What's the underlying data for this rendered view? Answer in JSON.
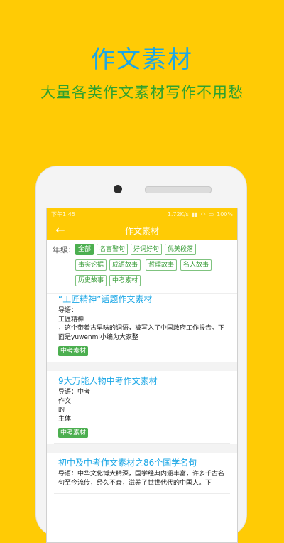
{
  "promo": {
    "headline": "作文素材",
    "subline": "大量各类作文素材写作不用愁"
  },
  "statusbar": {
    "time": "下午1:45",
    "network": "1.72K/s",
    "battery": "100%"
  },
  "appbar": {
    "title": "作文素材",
    "back_icon": "arrow-left-icon"
  },
  "filters": {
    "label": "年级:",
    "chips": [
      "全部",
      "名言警句",
      "好词好句",
      "优美段落",
      "事实论据",
      "成语故事",
      "哲理故事",
      "名人故事",
      "历史故事",
      "中考素材"
    ],
    "active_index": 0
  },
  "articles": [
    {
      "title": "“工匠精神”话题作文素材",
      "body": "导语：\n工匠精神\n，这个带着古早味的词语，被写入了中国政府工作报告。下面是yuwenmi小编为大家整",
      "tag": "中考素材"
    },
    {
      "title": "9大万能人物中考作文素材",
      "body": "导语：中考\n作文\n的\n主体",
      "tag": "中考素材"
    },
    {
      "title": "初中及中考作文素材之86个国学名句",
      "body": "导语：中华文化博大精深，国学经典内涵丰富，许多千古名句至今流传，经久不衰，滋养了世世代代的中国人。下",
      "tag": "中考素材"
    }
  ],
  "colors": {
    "background": "#FFCB05",
    "headline": "#1CA7E6",
    "subline": "#2FA12F",
    "chip_active": "#4CAF50"
  }
}
